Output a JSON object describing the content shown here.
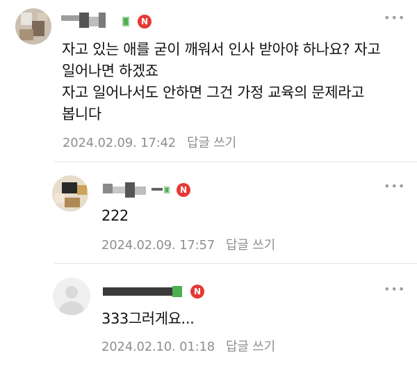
{
  "comments": [
    {
      "text": "자고 있는 애를 굳이 깨워서 인사 받아야 하나요? 자고\n일어나면 하겠죠\n자고 일어나서도 안하면 그건 가정 교육의 문제라고\n봅니다",
      "date": "2024.02.09. 17:42",
      "reply_label": "답글 쓰기",
      "badge": "N"
    },
    {
      "text": "222",
      "date": "2024.02.09. 17:57",
      "reply_label": "답글 쓰기",
      "badge": "N"
    },
    {
      "text": "333그러게요...",
      "date": "2024.02.10. 01:18",
      "reply_label": "답글 쓰기",
      "badge": "N"
    }
  ],
  "icons": {
    "more": "more-options-icon",
    "badge": "new-badge-icon"
  },
  "colors": {
    "badge": "#e53935",
    "meta_text": "#8e8e8e",
    "divider": "#e3e3e3"
  }
}
